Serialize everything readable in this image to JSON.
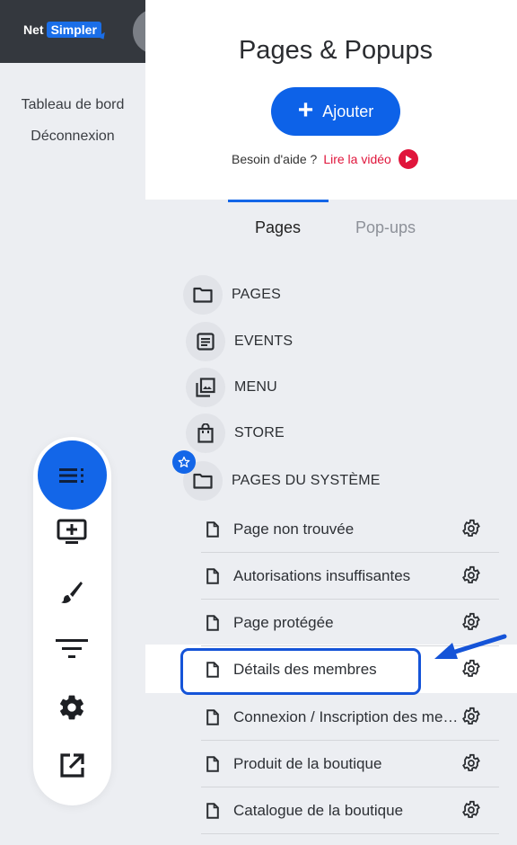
{
  "brand": {
    "part1": "Net",
    "part2": "Simpler"
  },
  "left_nav": {
    "dashboard": "Tableau de bord",
    "logout": "Déconnexion"
  },
  "panel": {
    "title": "Pages & Popups",
    "add_label": "Ajouter",
    "help_text": "Besoin d'aide ?",
    "help_link": "Lire la vidéo"
  },
  "tabs": {
    "pages": "Pages",
    "popups": "Pop-ups"
  },
  "folders": [
    {
      "label": "PAGES",
      "icon": "folder-icon"
    },
    {
      "label": "EVENTS",
      "icon": "article-icon"
    },
    {
      "label": "MENU",
      "icon": "photo-library-icon"
    },
    {
      "label": "STORE",
      "icon": "shopping-bag-icon"
    },
    {
      "label": "PAGES DU SYSTÈME",
      "icon": "folder-icon"
    }
  ],
  "system_pages": [
    {
      "label": "Page non trouvée"
    },
    {
      "label": "Autorisations insuffisantes"
    },
    {
      "label": "Page protégée"
    },
    {
      "label": "Détails des membres"
    },
    {
      "label": "Connexion / Inscription des membres"
    },
    {
      "label": "Produit de la boutique"
    },
    {
      "label": "Catalogue de la boutique"
    }
  ],
  "colors": {
    "accent": "#1366e8",
    "link": "#e0153b",
    "header_dark": "#34383e"
  }
}
